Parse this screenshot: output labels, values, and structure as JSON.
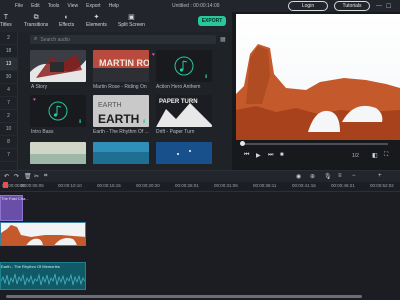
{
  "menu": {
    "items": [
      "File",
      "Edit",
      "Tools",
      "View",
      "Export",
      "Help"
    ],
    "doc_title": "Untitled : 00:00:14:09",
    "login": "Login",
    "tutorials": "Tutorials"
  },
  "toolbar": {
    "tools": [
      {
        "label": "Titles",
        "icon": "titles-icon"
      },
      {
        "label": "Transitions",
        "icon": "transitions-icon"
      },
      {
        "label": "Effects",
        "icon": "effects-icon"
      },
      {
        "label": "Elements",
        "icon": "elements-icon"
      },
      {
        "label": "Split Screen",
        "icon": "split-screen-icon"
      }
    ],
    "export": "EXPORT"
  },
  "gutter": [
    "2",
    "18",
    "13",
    "30",
    "4",
    "7",
    "2",
    "10",
    "8",
    "7"
  ],
  "media": {
    "search_placeholder": "Search audio",
    "items": [
      {
        "label": "A Story"
      },
      {
        "label": "Martin Rose - Riding On"
      },
      {
        "label": "Action Hero Anthem"
      },
      {
        "label": "Intro Bass"
      },
      {
        "label": "Earth - The Rhythm Of ..."
      },
      {
        "label": "Drift - Paper Turn"
      },
      {
        "label": ""
      },
      {
        "label": ""
      },
      {
        "label": ""
      }
    ],
    "thumb_texts": {
      "martin": "MARTIN ROSE",
      "earth": "EARTH",
      "paper": "PAPER TURN"
    }
  },
  "preview": {
    "page": "1/2",
    "progress": 0.0
  },
  "timeline": {
    "ruler": [
      "00:00:00:00",
      "00:00:05:05",
      "00:00:10:10",
      "00:00:15:15",
      "00:00:20:20",
      "00:00:26:01",
      "00:00:31:06",
      "00:00:36:11",
      "00:00:41:16",
      "00:00:46:21",
      "00:00:52:02"
    ],
    "title_clip": "The Fast Cha...",
    "audio_clip": "Earth - The Rhythm Of Memories"
  },
  "colors": {
    "accent": "#25c99a",
    "title_clip": "#6a4fa8",
    "audio_clip": "#0f5a66"
  }
}
